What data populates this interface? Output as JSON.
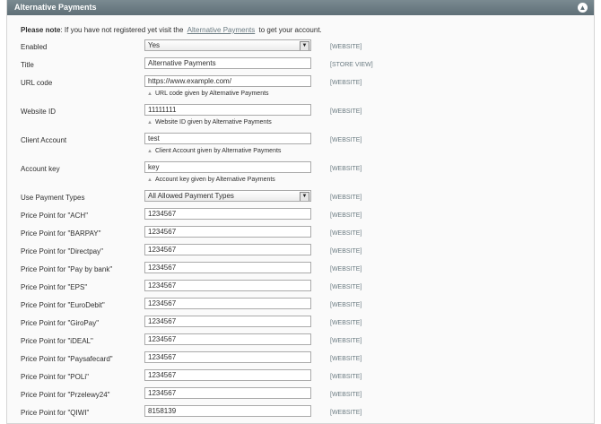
{
  "section": {
    "title": "Alternative Payments"
  },
  "note": {
    "prefix": "Please note",
    "text": ": If you have not registered yet visit the",
    "link": "Alternative Payments",
    "suffix": "to get your account."
  },
  "rows": [
    {
      "label": "Enabled",
      "value": "Yes",
      "kind": "select",
      "scope": "[WEBSITE]",
      "hint": ""
    },
    {
      "label": "Title",
      "value": "Alternative Payments",
      "kind": "input",
      "scope": "[STORE VIEW]",
      "hint": ""
    },
    {
      "label": "URL code",
      "value": "https://www.example.com/",
      "kind": "input",
      "scope": "[WEBSITE]",
      "hint": "URL code given by Alternative Payments"
    },
    {
      "label": "Website ID",
      "value": "11111111",
      "kind": "input",
      "scope": "[WEBSITE]",
      "hint": "Website ID given by Alternative Payments"
    },
    {
      "label": "Client Account",
      "value": "test",
      "kind": "input",
      "scope": "[WEBSITE]",
      "hint": "Client Account given by Alternative Payments"
    },
    {
      "label": "Account key",
      "value": "key",
      "kind": "input",
      "scope": "[WEBSITE]",
      "hint": "Account key given by Alternative Payments"
    },
    {
      "label": "Use Payment Types",
      "value": "All Allowed Payment Types",
      "kind": "select",
      "scope": "[WEBSITE]",
      "hint": ""
    },
    {
      "label": "Price Point for \"ACH\"",
      "value": "1234567",
      "kind": "input",
      "scope": "[WEBSITE]",
      "hint": ""
    },
    {
      "label": "Price Point for \"BARPAY\"",
      "value": "1234567",
      "kind": "input",
      "scope": "[WEBSITE]",
      "hint": ""
    },
    {
      "label": "Price Point for \"Directpay\"",
      "value": "1234567",
      "kind": "input",
      "scope": "[WEBSITE]",
      "hint": ""
    },
    {
      "label": "Price Point for \"Pay by bank\"",
      "value": "1234567",
      "kind": "input",
      "scope": "[WEBSITE]",
      "hint": ""
    },
    {
      "label": "Price Point for \"EPS\"",
      "value": "1234567",
      "kind": "input",
      "scope": "[WEBSITE]",
      "hint": ""
    },
    {
      "label": "Price Point for \"EuroDebit\"",
      "value": "1234567",
      "kind": "input",
      "scope": "[WEBSITE]",
      "hint": ""
    },
    {
      "label": "Price Point for \"GiroPay\"",
      "value": "1234567",
      "kind": "input",
      "scope": "[WEBSITE]",
      "hint": ""
    },
    {
      "label": "Price Point for \"iDEAL\"",
      "value": "1234567",
      "kind": "input",
      "scope": "[WEBSITE]",
      "hint": ""
    },
    {
      "label": "Price Point for \"Paysafecard\"",
      "value": "1234567",
      "kind": "input",
      "scope": "[WEBSITE]",
      "hint": ""
    },
    {
      "label": "Price Point for \"POLi\"",
      "value": "1234567",
      "kind": "input",
      "scope": "[WEBSITE]",
      "hint": ""
    },
    {
      "label": "Price Point for \"Przelewy24\"",
      "value": "1234567",
      "kind": "input",
      "scope": "[WEBSITE]",
      "hint": ""
    },
    {
      "label": "Price Point for \"QIWI\"",
      "value": "8158139",
      "kind": "input",
      "scope": "[WEBSITE]",
      "hint": ""
    }
  ]
}
